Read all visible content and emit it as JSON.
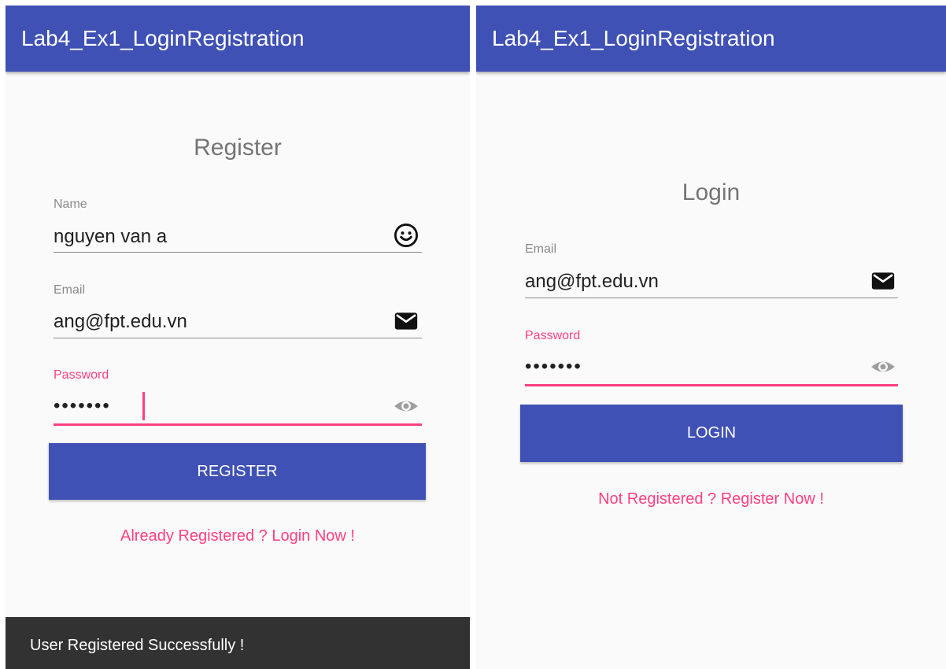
{
  "register_screen": {
    "app_title": "Lab4_Ex1_LoginRegistration",
    "form_title": "Register",
    "name_field": {
      "label": "Name",
      "value": "nguyen van a",
      "icon": "smiley-face-icon"
    },
    "email_field": {
      "label": "Email",
      "value": "ang@fpt.edu.vn",
      "icon": "envelope-icon"
    },
    "password_field": {
      "label": "Password",
      "value": "•••••••",
      "icon": "eye-icon",
      "focused": true
    },
    "submit_label": "REGISTER",
    "switch_link": "Already Registered ? Login Now !",
    "snackbar_message": "User Registered Successfully !"
  },
  "login_screen": {
    "app_title": "Lab4_Ex1_LoginRegistration",
    "form_title": "Login",
    "email_field": {
      "label": "Email",
      "value": "ang@fpt.edu.vn",
      "icon": "envelope-icon"
    },
    "password_field": {
      "label": "Password",
      "value": "•••••••",
      "icon": "eye-icon",
      "focused": true
    },
    "submit_label": "LOGIN",
    "switch_link": "Not Registered ? Register Now !"
  },
  "colors": {
    "primary": "#3f51b5",
    "accent": "#ff4081",
    "background": "#fafafa",
    "snackbar": "#323232"
  }
}
